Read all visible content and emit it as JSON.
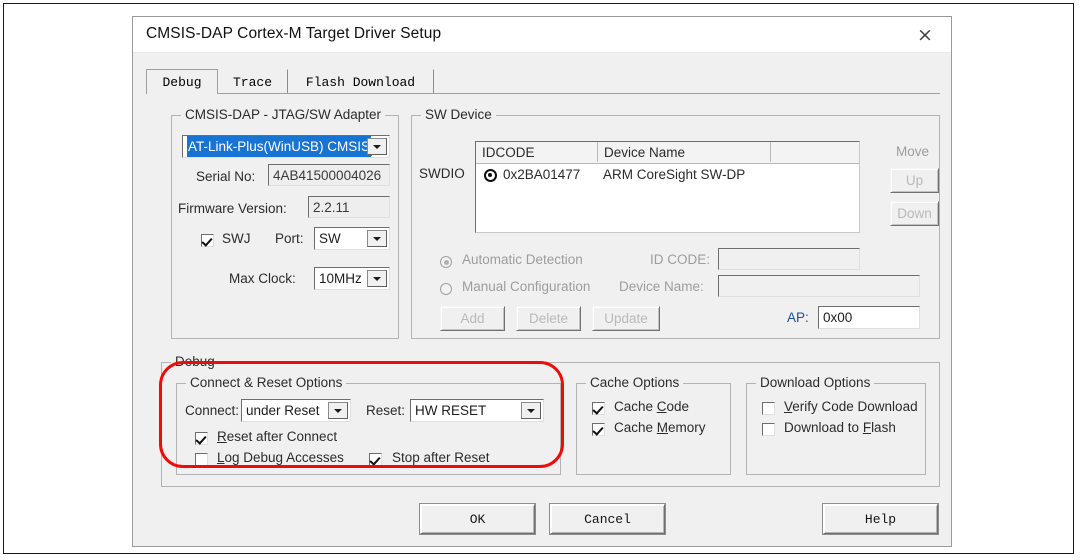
{
  "dialog": {
    "title": "CMSIS-DAP Cortex-M Target Driver Setup",
    "close_icon": "×"
  },
  "tabs": [
    {
      "label": "Debug",
      "active": true
    },
    {
      "label": "Trace",
      "active": false
    },
    {
      "label": "Flash Download",
      "active": false
    }
  ],
  "adapter_group": {
    "legend": "CMSIS-DAP - JTAG/SW Adapter",
    "adapter_combo": {
      "value": "AT-Link-Plus(WinUSB) CMSIS",
      "selected": true
    },
    "serial_label": "Serial No:",
    "serial_value": "4AB41500004026",
    "firmware_label": "Firmware Version:",
    "firmware_value": "2.2.11",
    "swj_label": "SWJ",
    "swj_checked": true,
    "port_label": "Port:",
    "port_value": "SW",
    "max_clock_label": "Max Clock:",
    "max_clock_value": "10MHz"
  },
  "sw_device_group": {
    "legend": "SW Device",
    "swdio_label": "SWDIO",
    "table": {
      "columns": [
        "IDCODE",
        "Device Name",
        ""
      ],
      "rows": [
        {
          "selected": true,
          "idcode": "0x2BA01477",
          "device_name": "ARM CoreSight SW-DP"
        }
      ]
    },
    "move_label": "Move",
    "up_label": "Up",
    "down_label": "Down",
    "automatic_detection_label": "Automatic Detection",
    "automatic_detection_selected": true,
    "manual_configuration_label": "Manual Configuration",
    "manual_configuration_selected": false,
    "id_code_label": "ID CODE:",
    "id_code_value": "",
    "device_name_label": "Device Name:",
    "device_name_value": "",
    "add_label": "Add",
    "delete_label": "Delete",
    "update_label": "Update",
    "ap_label": "AP:",
    "ap_value": "0x00"
  },
  "debug_group": {
    "legend": "Debug",
    "connect_reset": {
      "legend": "Connect & Reset Options",
      "connect_label": "Connect:",
      "connect_value": "under Reset",
      "reset_label": "Reset:",
      "reset_value": "HW RESET",
      "reset_after_connect_label": "Reset after Connect",
      "reset_after_connect_checked": true,
      "log_debug_accesses_label": "Log Debug Accesses",
      "log_debug_accesses_checked": false,
      "stop_after_reset_label": "Stop after Reset",
      "stop_after_reset_checked": true
    },
    "cache_options": {
      "legend": "Cache Options",
      "cache_code_label": "Cache Code",
      "cache_code_checked": true,
      "cache_memory_label": "Cache Memory",
      "cache_memory_checked": true
    },
    "download_options": {
      "legend": "Download Options",
      "verify_code_download_label": "Verify Code Download",
      "verify_code_download_checked": false,
      "download_to_flash_label": "Download to Flash",
      "download_to_flash_checked": false
    }
  },
  "footer": {
    "ok_label": "OK",
    "cancel_label": "Cancel",
    "help_label": "Help"
  },
  "annotation": {
    "highlight_color": "#f10a0a",
    "highlight_target": "Connect & Reset Options"
  }
}
